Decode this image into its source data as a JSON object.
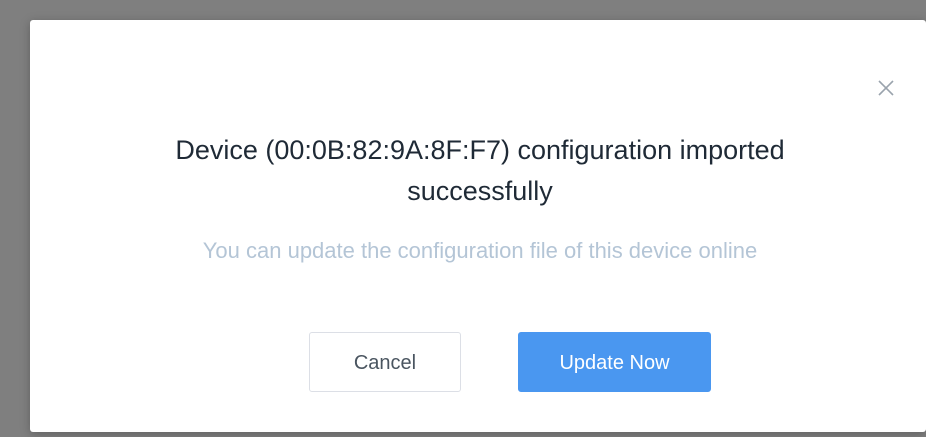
{
  "dialog": {
    "title_line1": "Device (00:0B:82:9A:8F:F7) configuration imported",
    "title_line2": "successfully",
    "subtitle": "You can update the configuration file of this device online",
    "close_icon": "close-icon",
    "buttons": {
      "cancel_label": "Cancel",
      "primary_label": "Update Now"
    }
  },
  "colors": {
    "primary": "#4a97f0",
    "title_text": "#1f2a36",
    "subtitle_text": "#b4c5d6",
    "overlay": "#7f7f7f"
  }
}
